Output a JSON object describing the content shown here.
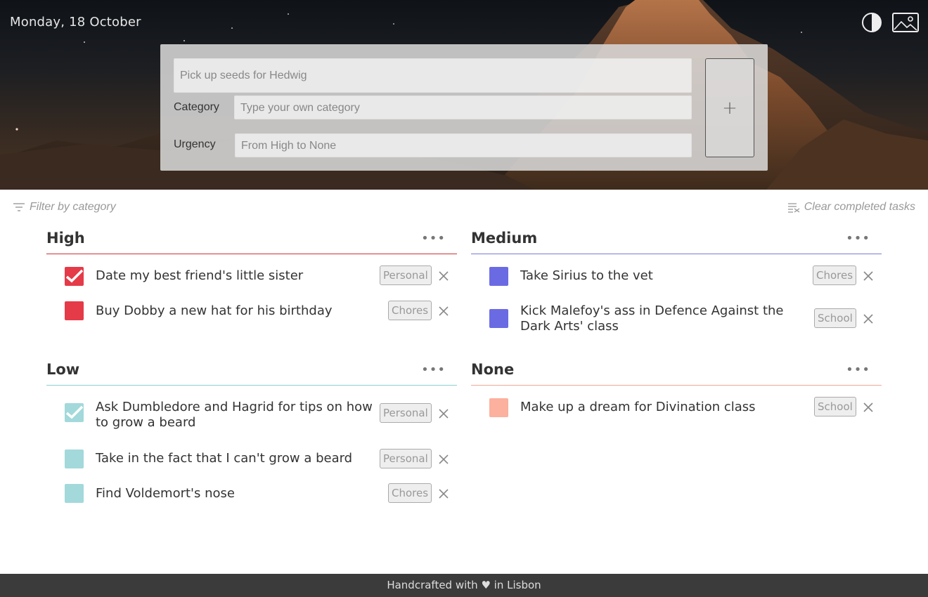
{
  "header": {
    "date": "Monday, 18 October",
    "contrast_icon": "contrast-icon",
    "image_icon": "image-icon"
  },
  "form": {
    "task_placeholder": "Pick up seeds for Hedwig",
    "category_label": "Category",
    "category_placeholder": "Type your own category",
    "urgency_label": "Urgency",
    "urgency_placeholder": "From High to None",
    "add_label": "+"
  },
  "toolbar": {
    "filter_label": "Filter by category",
    "clear_label": "Clear completed tasks"
  },
  "groups": {
    "high": {
      "title": "High",
      "color": "#e53a48",
      "tasks": [
        {
          "text": "Date my best friend's little sister",
          "tag": "Personal",
          "done": true
        },
        {
          "text": "Buy Dobby a new hat for his birthday",
          "tag": "Chores",
          "done": false
        }
      ]
    },
    "medium": {
      "title": "Medium",
      "color": "#6a6be3",
      "tasks": [
        {
          "text": "Take Sirius to the vet",
          "tag": "Chores",
          "done": false
        },
        {
          "text": "Kick Malefoy's ass in Defence Against the Dark Arts' class",
          "tag": "School",
          "done": false
        }
      ]
    },
    "low": {
      "title": "Low",
      "color": "#a3d9db",
      "tasks": [
        {
          "text": "Ask Dumbledore and Hagrid for tips on how to grow a beard",
          "tag": "Personal",
          "done": true
        },
        {
          "text": "Take in the fact that I can't grow a beard",
          "tag": "Personal",
          "done": false
        },
        {
          "text": "Find Voldemort's nose",
          "tag": "Chores",
          "done": false
        }
      ]
    },
    "none": {
      "title": "None",
      "color": "#fcb09e",
      "tasks": [
        {
          "text": "Make up a dream for Divination class",
          "tag": "School",
          "done": false
        }
      ]
    }
  },
  "footer": {
    "text": "Handcrafted with ♥ in Lisbon"
  }
}
